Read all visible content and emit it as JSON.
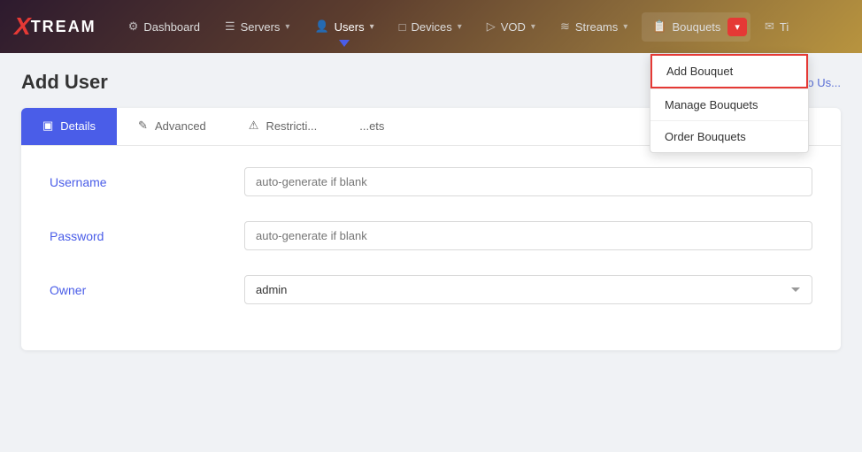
{
  "app": {
    "logo_x": "X",
    "logo_text": "TREAM"
  },
  "nav": {
    "items": [
      {
        "id": "dashboard",
        "label": "Dashboard",
        "icon": "⚙",
        "has_dropdown": false
      },
      {
        "id": "servers",
        "label": "Servers",
        "icon": "☰",
        "has_dropdown": true
      },
      {
        "id": "users",
        "label": "Users",
        "icon": "👤",
        "has_dropdown": true,
        "active": true
      },
      {
        "id": "devices",
        "label": "Devices",
        "icon": "□",
        "has_dropdown": true
      },
      {
        "id": "vod",
        "label": "VOD",
        "icon": "▷",
        "has_dropdown": true
      },
      {
        "id": "streams",
        "label": "Streams",
        "icon": "≋",
        "has_dropdown": true
      },
      {
        "id": "bouquets",
        "label": "Bouquets",
        "icon": "📋",
        "has_dropdown": true
      }
    ]
  },
  "dropdown": {
    "items": [
      {
        "id": "add-bouquet",
        "label": "Add Bouquet",
        "highlighted": true
      },
      {
        "id": "manage-bouquets",
        "label": "Manage Bouquets",
        "highlighted": false
      },
      {
        "id": "order-bouquets",
        "label": "Order Bouquets",
        "highlighted": false
      }
    ]
  },
  "page": {
    "title": "Add User",
    "back_label": "Back to Us..."
  },
  "tabs": [
    {
      "id": "details",
      "label": "Details",
      "icon": "▣",
      "active": true
    },
    {
      "id": "advanced",
      "label": "Advanced",
      "icon": "✎",
      "active": false
    },
    {
      "id": "restrictions",
      "label": "Restricti...",
      "icon": "⚠",
      "active": false
    },
    {
      "id": "bouquets",
      "label": "...ets",
      "icon": "",
      "active": false
    }
  ],
  "form": {
    "username_label": "Username",
    "username_placeholder": "auto-generate if blank",
    "password_label": "Password",
    "password_placeholder": "auto-generate if blank",
    "owner_label": "Owner",
    "owner_value": "admin",
    "owner_options": [
      "admin"
    ]
  }
}
